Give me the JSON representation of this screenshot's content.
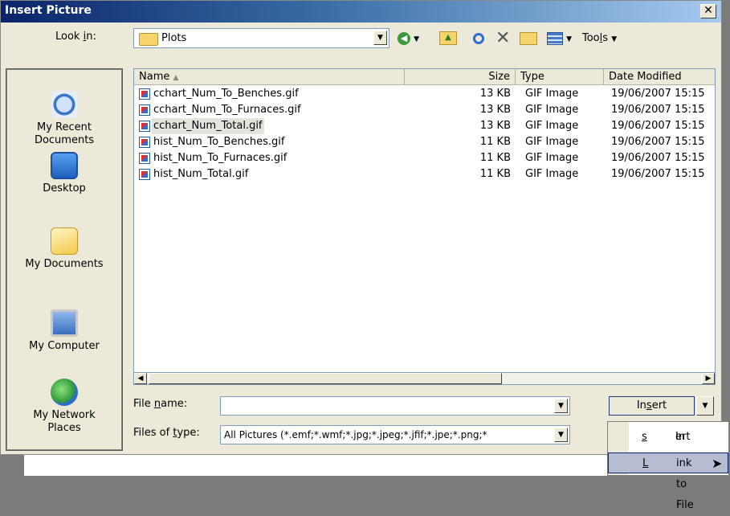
{
  "window": {
    "title": "Insert Picture",
    "close_glyph": "✕"
  },
  "lookin": {
    "label_pre": "Look ",
    "label_ul": "i",
    "label_post": "n:",
    "value": "Plots"
  },
  "toolbar": {
    "back_icon": "back-arrow-icon",
    "up_icon": "up-folder-icon",
    "search_icon": "search-web-icon",
    "delete_icon": "delete-icon",
    "newfolder_icon": "new-folder-icon",
    "views_icon": "views-icon",
    "tools_label_pre": "Too",
    "tools_label_ul": "l",
    "tools_label_post": "s"
  },
  "places": [
    {
      "label": "My Recent Documents",
      "icon": "recent-documents-icon"
    },
    {
      "label": "Desktop",
      "icon": "desktop-icon"
    },
    {
      "label": "My Documents",
      "icon": "my-documents-icon"
    },
    {
      "label": "My Computer",
      "icon": "my-computer-icon"
    },
    {
      "label": "My Network Places",
      "icon": "network-places-icon"
    }
  ],
  "columns": {
    "name": "Name",
    "size": "Size",
    "type": "Type",
    "date": "Date Modified"
  },
  "files": [
    {
      "name": "cchart_Num_To_Benches.gif",
      "size": "13 KB",
      "type": "GIF Image",
      "date": "19/06/2007 15:15"
    },
    {
      "name": "cchart_Num_To_Furnaces.gif",
      "size": "13 KB",
      "type": "GIF Image",
      "date": "19/06/2007 15:15"
    },
    {
      "name": "cchart_Num_Total.gif",
      "size": "13 KB",
      "type": "GIF Image",
      "date": "19/06/2007 15:15"
    },
    {
      "name": "hist_Num_To_Benches.gif",
      "size": "11 KB",
      "type": "GIF Image",
      "date": "19/06/2007 15:15"
    },
    {
      "name": "hist_Num_To_Furnaces.gif",
      "size": "11 KB",
      "type": "GIF Image",
      "date": "19/06/2007 15:15"
    },
    {
      "name": "hist_Num_Total.gif",
      "size": "11 KB",
      "type": "GIF Image",
      "date": "19/06/2007 15:15"
    }
  ],
  "filename": {
    "label_pre": "File ",
    "label_ul": "n",
    "label_post": "ame:",
    "value": ""
  },
  "filetype": {
    "label_pre": "Files of ",
    "label_ul": "t",
    "label_post": "ype:",
    "value": "All Pictures (*.emf;*.wmf;*.jpg;*.jpeg;*.jfif;*.jpe;*.png;*"
  },
  "insert_button": {
    "pre": "In",
    "ul": "s",
    "post": "ert"
  },
  "menu": {
    "insert": {
      "pre": "In",
      "ul": "s",
      "post": "ert"
    },
    "link": {
      "pre": "",
      "ul": "L",
      "post": "ink to File"
    }
  },
  "colors": {
    "title_bar": "#0a246a",
    "selection": "#b6bdd2"
  }
}
